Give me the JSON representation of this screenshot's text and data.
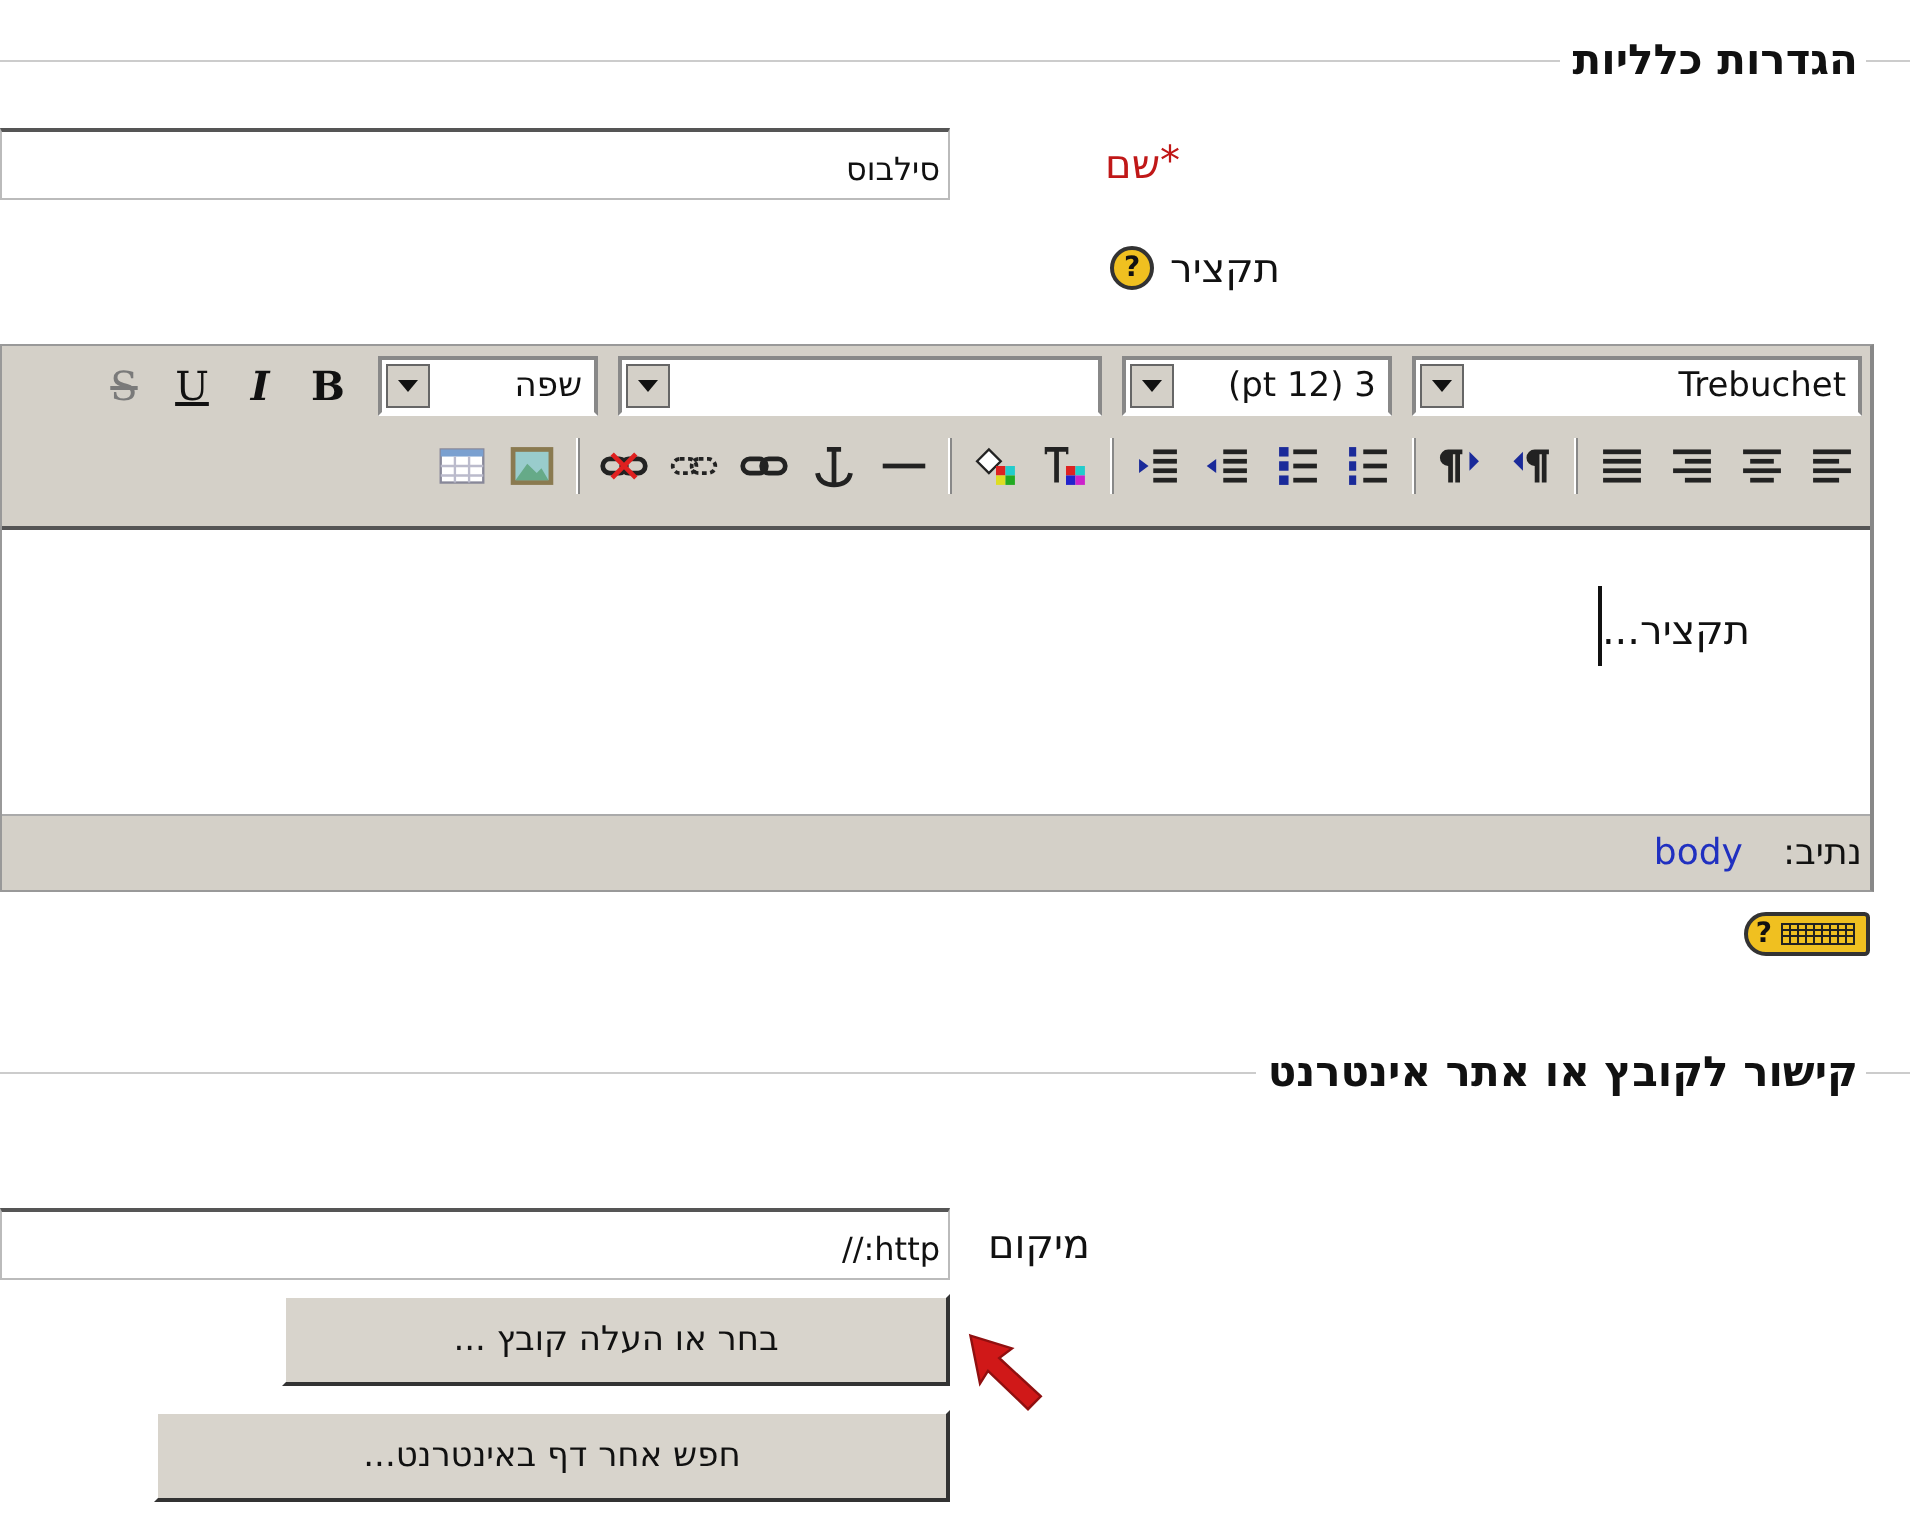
{
  "general_section": {
    "title": "הגדרות כלליות",
    "name_field": {
      "label": "שם",
      "required_mark": "*",
      "value": "סילבוס"
    },
    "summary": {
      "label": "תקציר",
      "help_mark": "?",
      "editor": {
        "font_select": {
          "value": "Trebuchet"
        },
        "size_select": {
          "value": "3 (12 pt)"
        },
        "language_select": {
          "value": "שפה"
        },
        "format_buttons": [
          {
            "label": "B",
            "kind": "bold",
            "disabled": false
          },
          {
            "label": "I",
            "kind": "italic",
            "disabled": false
          },
          {
            "label": "U",
            "kind": "underline",
            "disabled": false
          },
          {
            "label": "S",
            "kind": "strike",
            "disabled": true
          }
        ],
        "content": "תקציר...",
        "path_label": "נתיב:",
        "path_value": "body",
        "help_mark": "?"
      }
    }
  },
  "link_section": {
    "title": "קישור לקובץ או אתר אינטרנט",
    "location_field": {
      "label": "מיקום",
      "value": "http://"
    },
    "buttons": [
      {
        "label": "בחר או העלה קובץ ..."
      },
      {
        "label": "חפש אחר דף באינטרנט..."
      }
    ]
  }
}
